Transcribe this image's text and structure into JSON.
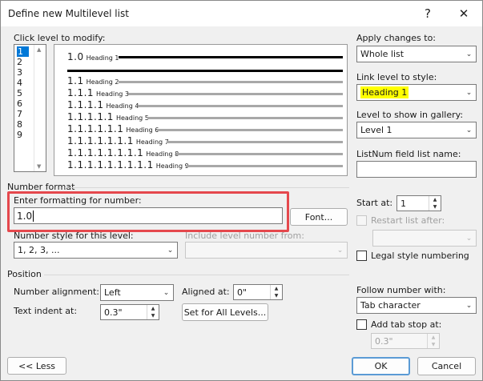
{
  "window": {
    "title": "Define new Multilevel list",
    "help_label": "?",
    "close_label": "✕"
  },
  "levels": {
    "label": "Click level to modify:",
    "items": [
      "1",
      "2",
      "3",
      "4",
      "5",
      "6",
      "7",
      "8",
      "9"
    ],
    "selected": "1"
  },
  "preview": {
    "rows": [
      {
        "num": "1.0",
        "heading": "Heading 1"
      },
      {
        "num": "1.1",
        "heading": "Heading 2"
      },
      {
        "num": "1.1.1",
        "heading": "Heading 3"
      },
      {
        "num": "1.1.1.1",
        "heading": "Heading 4"
      },
      {
        "num": "1.1.1.1.1",
        "heading": "Heading 5"
      },
      {
        "num": "1.1.1.1.1.1",
        "heading": "Heading 6"
      },
      {
        "num": "1.1.1.1.1.1.1",
        "heading": "Heading 7"
      },
      {
        "num": "1.1.1.1.1.1.1.1",
        "heading": "Heading 8"
      },
      {
        "num": "1.1.1.1.1.1.1.1.1",
        "heading": "Heading 9"
      }
    ]
  },
  "right_panel": {
    "apply_label": "Apply changes to:",
    "apply_value": "Whole list",
    "link_label": "Link level to style:",
    "link_value": "Heading 1",
    "gallery_label": "Level to show in gallery:",
    "gallery_value": "Level 1",
    "listnum_label": "ListNum field list name:",
    "listnum_value": ""
  },
  "number_format": {
    "section_label": "Number format",
    "enter_label": "Enter formatting for number:",
    "enter_value": "1.0",
    "font_button": "Font...",
    "style_label": "Number style for this level:",
    "style_value": "1, 2, 3, ...",
    "include_label": "Include level number from:",
    "include_value": "",
    "start_label": "Start at:",
    "start_value": "1",
    "restart_label": "Restart list after:",
    "restart_value": "",
    "legal_label": "Legal style numbering"
  },
  "position": {
    "section_label": "Position",
    "alignment_label": "Number alignment:",
    "alignment_value": "Left",
    "aligned_at_label": "Aligned at:",
    "aligned_at_value": "0\"",
    "indent_label": "Text indent at:",
    "indent_value": "0.3\"",
    "set_all_button": "Set for All Levels...",
    "follow_label": "Follow number with:",
    "follow_value": "Tab character",
    "tab_stop_label": "Add tab stop at:",
    "tab_stop_value": "0.3\""
  },
  "footer": {
    "less_button": "<< Less",
    "ok_button": "OK",
    "cancel_button": "Cancel"
  },
  "colors": {
    "highlight_red": "#e5484d",
    "highlight_yellow": "#ffff00",
    "selection_blue": "#0078d7"
  }
}
